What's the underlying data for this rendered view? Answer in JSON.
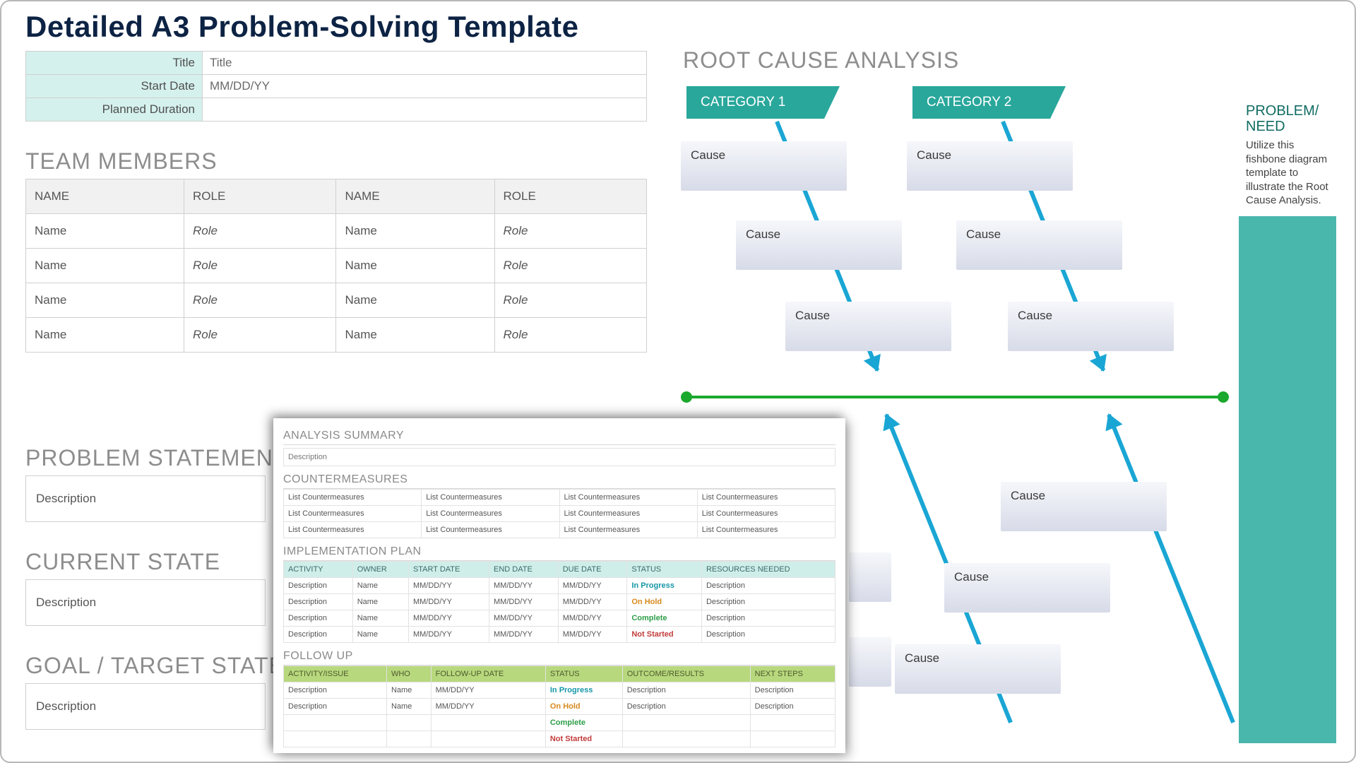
{
  "title": "Detailed A3 Problem-Solving Template",
  "meta": {
    "title_label": "Title",
    "title_value": "Title",
    "start_label": "Start Date",
    "start_value": "MM/DD/YY",
    "duration_label": "Planned Duration",
    "duration_value": ""
  },
  "team": {
    "heading": "TEAM MEMBERS",
    "cols": [
      "NAME",
      "ROLE",
      "NAME",
      "ROLE"
    ],
    "rows": [
      [
        "Name",
        "Role",
        "Name",
        "Role"
      ],
      [
        "Name",
        "Role",
        "Name",
        "Role"
      ],
      [
        "Name",
        "Role",
        "Name",
        "Role"
      ],
      [
        "Name",
        "Role",
        "Name",
        "Role"
      ]
    ]
  },
  "problem": {
    "heading": "PROBLEM STATEMENT",
    "desc": "Description"
  },
  "current": {
    "heading": "CURRENT STATE",
    "desc": "Description"
  },
  "goal": {
    "heading": "GOAL / TARGET STATE",
    "desc": "Description"
  },
  "rca": {
    "heading": "ROOT CAUSE ANALYSIS",
    "cat1": "CATEGORY 1",
    "cat2": "CATEGORY 2",
    "cause": "Cause",
    "need_title": "PROBLEM/ NEED",
    "need_text": "Utilize this fishbone diagram template to illustrate the Root Cause Analysis."
  },
  "sheet": {
    "analysis_h": "ANALYSIS SUMMARY",
    "analysis_desc": "Description",
    "counter_h": "COUNTERMEASURES",
    "counter_cell": "List Countermeasures",
    "impl_h": "IMPLEMENTATION PLAN",
    "impl_cols": [
      "ACTIVITY",
      "OWNER",
      "START DATE",
      "END DATE",
      "DUE DATE",
      "STATUS",
      "RESOURCES NEEDED"
    ],
    "impl_rows": [
      [
        "Description",
        "Name",
        "MM/DD/YY",
        "MM/DD/YY",
        "MM/DD/YY",
        "In Progress",
        "Description"
      ],
      [
        "Description",
        "Name",
        "MM/DD/YY",
        "MM/DD/YY",
        "MM/DD/YY",
        "On Hold",
        "Description"
      ],
      [
        "Description",
        "Name",
        "MM/DD/YY",
        "MM/DD/YY",
        "MM/DD/YY",
        "Complete",
        "Description"
      ],
      [
        "Description",
        "Name",
        "MM/DD/YY",
        "MM/DD/YY",
        "MM/DD/YY",
        "Not Started",
        "Description"
      ]
    ],
    "follow_h": "FOLLOW UP",
    "follow_cols": [
      "ACTIVITY/ISSUE",
      "WHO",
      "FOLLOW-UP DATE",
      "STATUS",
      "OUTCOME/RESULTS",
      "NEXT STEPS"
    ],
    "follow_rows": [
      [
        "Description",
        "Name",
        "MM/DD/YY",
        "In Progress",
        "Description",
        "Description"
      ],
      [
        "Description",
        "Name",
        "MM/DD/YY",
        "On Hold",
        "Description",
        "Description"
      ],
      [
        "",
        "",
        "",
        "Complete",
        "",
        ""
      ],
      [
        "",
        "",
        "",
        "Not Started",
        "",
        ""
      ]
    ]
  },
  "status_class": {
    "In Progress": "st-inprog",
    "On Hold": "st-hold",
    "Complete": "st-comp",
    "Not Started": "st-not"
  }
}
